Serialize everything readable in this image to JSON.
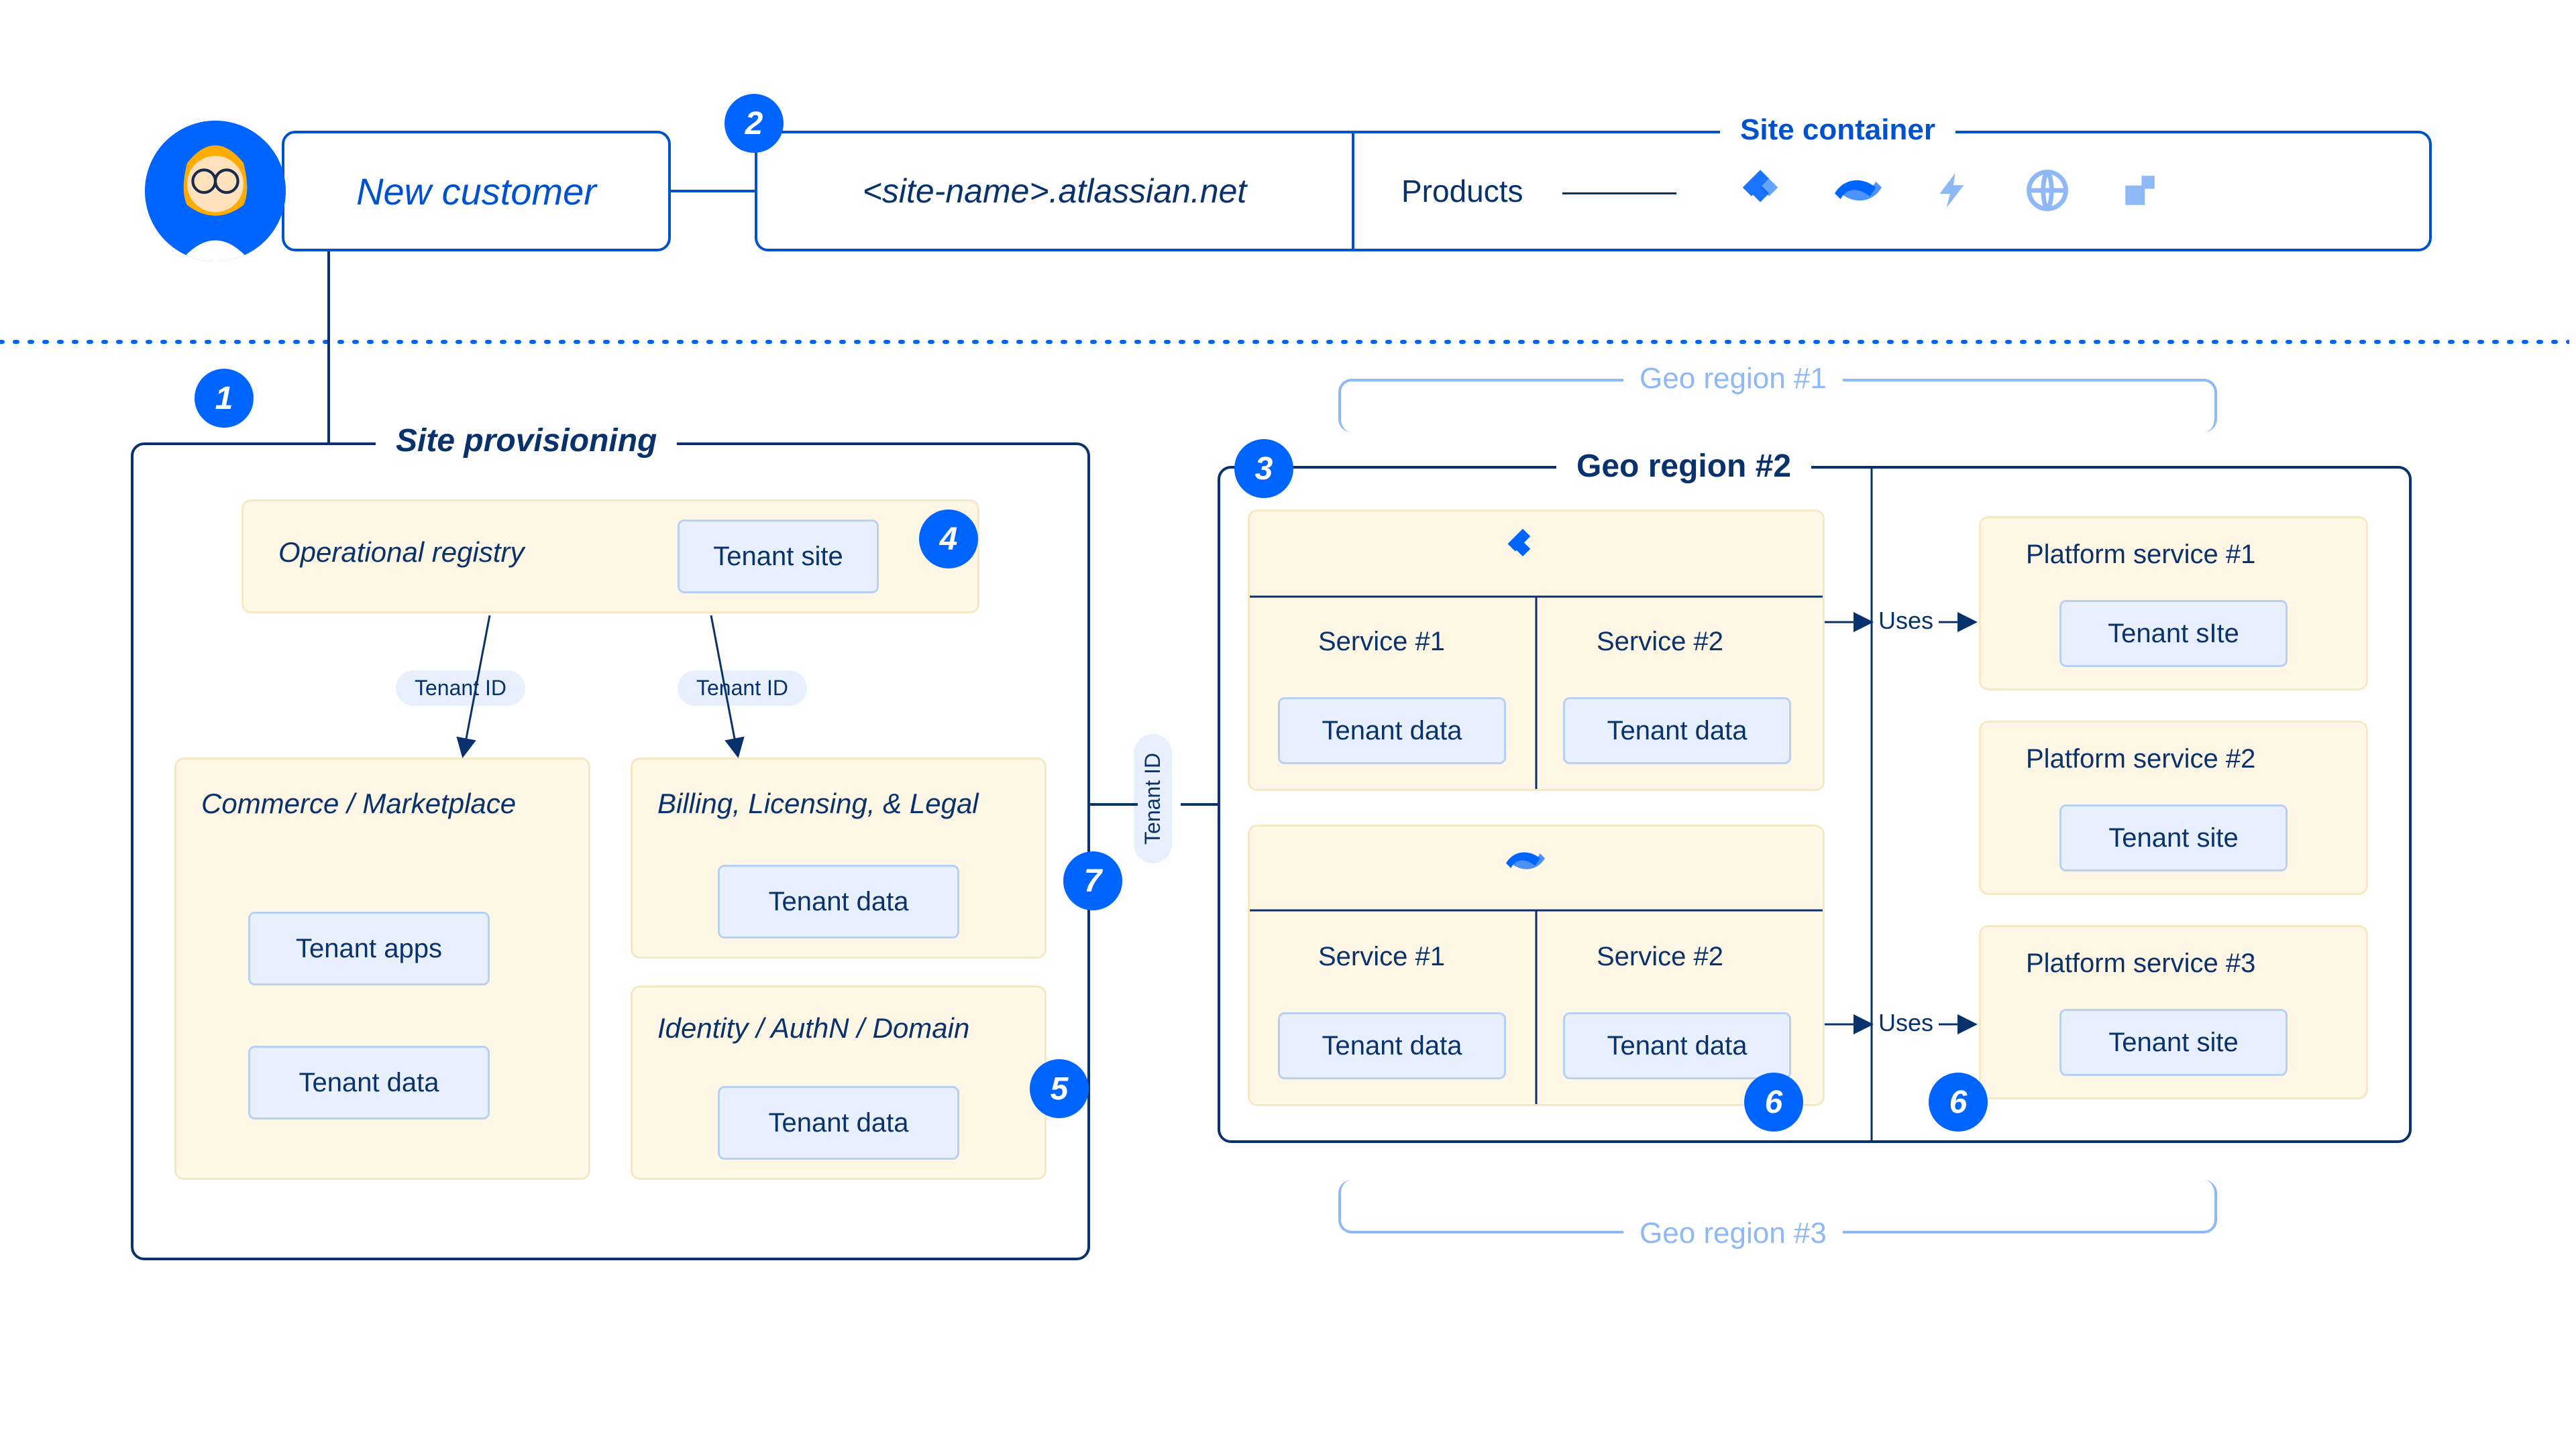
{
  "top": {
    "new_customer": "New customer",
    "site_name": "<site-name>.atlassian.net",
    "site_container": "Site container",
    "products": "Products"
  },
  "badges": {
    "b1": "1",
    "b2": "2",
    "b3": "3",
    "b4": "4",
    "b5": "5",
    "b6a": "6",
    "b6b": "6",
    "b7": "7"
  },
  "provisioning": {
    "title": "Site provisioning",
    "operational_registry": "Operational registry",
    "tenant_site": "Tenant site",
    "tenant_id_a": "Tenant ID",
    "tenant_id_b": "Tenant ID",
    "commerce": "Commerce / Marketplace",
    "tenant_apps": "Tenant apps",
    "tenant_data_c": "Tenant data",
    "billing": "Billing, Licensing, & Legal",
    "tenant_data_b": "Tenant data",
    "identity": "Identity / AuthN / Domain",
    "tenant_data_i": "Tenant data"
  },
  "connector": {
    "tenant_id": "Tenant ID"
  },
  "geo": {
    "region2": "Geo region #2",
    "region1": "Geo region #1",
    "region3": "Geo region #3",
    "service1": "Service #1",
    "service2": "Service #2",
    "tenant_data": "Tenant data",
    "platform1": "Platform service #1",
    "platform2": "Platform service #2",
    "platform3": "Platform service #3",
    "tenant_site1": "Tenant sIte",
    "tenant_site2": "Tenant site",
    "tenant_site3": "Tenant site",
    "uses": "Uses"
  }
}
